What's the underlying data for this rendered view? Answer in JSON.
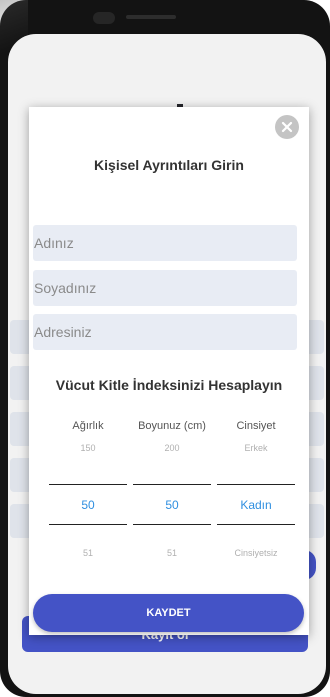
{
  "modal": {
    "title": "Kişisel Ayrıntıları Girin",
    "inputs": {
      "name_placeholder": "Adınız",
      "surname_placeholder": "Soyadınız",
      "address_placeholder": "Adresiniz"
    },
    "bmi": {
      "title": "Vücut Kitle İndeksinizi Hesaplayın",
      "weight": {
        "label": "Ağırlık",
        "above": "150",
        "value": "50",
        "below": "51"
      },
      "height": {
        "label": "Boyunuz (cm)",
        "above": "200",
        "value": "50",
        "below": "51"
      },
      "gender": {
        "label": "Cinsiyet",
        "above": "Erkek",
        "value": "Kadın",
        "below": "Cinsiyetsiz"
      }
    },
    "save_label": "KAYDET"
  },
  "register_label": "Kayıt ol",
  "colors": {
    "accent": "#4453c6",
    "picker_selected": "#2f8fe0",
    "input_bg": "#e8ecf4"
  },
  "icons": {
    "close": "close-icon",
    "illustration": "person-illustration"
  }
}
